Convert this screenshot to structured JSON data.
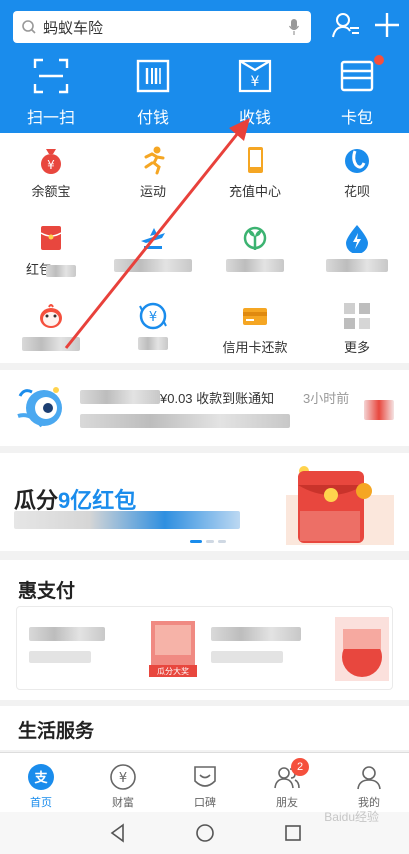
{
  "search": {
    "placeholder": "蚂蚁车险"
  },
  "quick_actions": [
    {
      "label": "扫一扫",
      "icon": "scan-icon"
    },
    {
      "label": "付钱",
      "icon": "barcode-icon"
    },
    {
      "label": "收钱",
      "icon": "receive-money-icon"
    },
    {
      "label": "卡包",
      "icon": "card-wallet-icon"
    }
  ],
  "apps": [
    {
      "label": "余额宝",
      "icon": "money-bag-icon",
      "color": "#e8473e"
    },
    {
      "label": "运动",
      "icon": "running-icon",
      "color": "#f5a623"
    },
    {
      "label": "充值中心",
      "icon": "phone-icon",
      "color": "#f5a623"
    },
    {
      "label": "花呗",
      "icon": "huabei-icon",
      "color": "#1a8cec"
    },
    {
      "label": "红包",
      "icon": "red-packet-icon",
      "color": "#e8473e"
    },
    {
      "label": "",
      "icon": "plane-icon",
      "color": "#1a8cec"
    },
    {
      "label": "",
      "icon": "sprout-icon",
      "color": "#3cb371"
    },
    {
      "label": "",
      "icon": "water-drop-icon",
      "color": "#1a8cec"
    },
    {
      "label": "",
      "icon": "chick-icon",
      "color": "#f5503d"
    },
    {
      "label": "",
      "icon": "yuan-circle-icon",
      "color": "#1a8cec"
    },
    {
      "label": "信用卡还款",
      "icon": "credit-card-icon",
      "color": "#f5a623"
    },
    {
      "label": "更多",
      "icon": "more-icon",
      "color": "#bbbbbb"
    }
  ],
  "notice": {
    "text": "¥0.03 收款到账通知",
    "time": "3小时前"
  },
  "banner": {
    "title_prefix": "瓜分",
    "title_highlight": "9亿红包"
  },
  "sections": {
    "hui": "惠支付",
    "life": "生活服务",
    "hui_badge": "瓜分大奖"
  },
  "tabs": [
    {
      "label": "首页",
      "icon": "home-icon",
      "active": true
    },
    {
      "label": "财富",
      "icon": "wealth-icon"
    },
    {
      "label": "口碑",
      "icon": "koubei-icon"
    },
    {
      "label": "朋友",
      "icon": "friends-icon",
      "badge": "2"
    },
    {
      "label": "我的",
      "icon": "profile-icon"
    }
  ],
  "watermark": "Baidu经验",
  "colors": {
    "primary": "#1a8cec",
    "alert": "#f5503d"
  }
}
